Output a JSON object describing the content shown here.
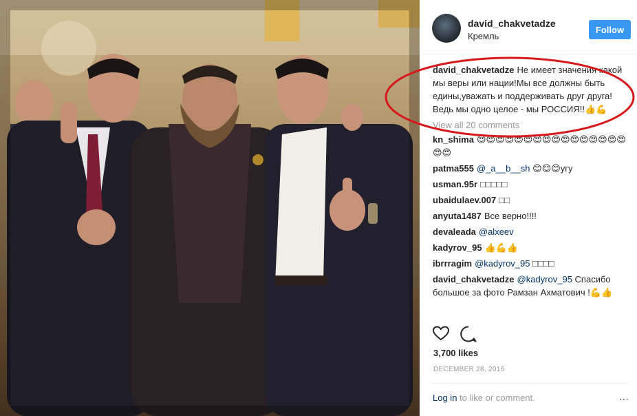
{
  "post": {
    "username": "david_chakvetadze",
    "location": "Кремль",
    "follow_label": "Follow",
    "caption_user": "david_chakvetadze",
    "caption_text": "Не имеет значения какой мы веры или нации!Мы все должны быть едины,уважать и поддерживать друг друга!Ведь мы одно целое - мы РОССИЯ!!👍💪",
    "view_all": "View all 20 comments",
    "likes": "3,700 likes",
    "date": "DECEMBER 28, 2016",
    "login_link": "Log in",
    "login_rest": " to like or comment.",
    "more_label": "···"
  },
  "comments": [
    {
      "user": "kn_shima",
      "mention": "",
      "text": "😍😍😍😍😍😍😍😍😍😍😍😍😍😍😍😍😍😍"
    },
    {
      "user": "patma555",
      "mention": "@_a__b__sh",
      "text": " 😊😊😊угу"
    },
    {
      "user": "usman.95r",
      "mention": "",
      "text": "□□□□□"
    },
    {
      "user": "ubaidulaev.007",
      "mention": "",
      "text": "□□"
    },
    {
      "user": "anyuta1487",
      "mention": "",
      "text": "Все верно!!!!"
    },
    {
      "user": "devaleada",
      "mention": "@alxeev",
      "text": ""
    },
    {
      "user": "kadyrov_95",
      "mention": "",
      "text": "👍💪👍"
    },
    {
      "user": "ibrrragim",
      "mention": "@kadyrov_95",
      "text": " □□□□"
    },
    {
      "user": "david_chakvetadze",
      "mention": "@kadyrov_95",
      "text": " Спасибо большое за фото Рамзан Ахматович !💪👍"
    }
  ],
  "icons": {
    "like": "heart-icon",
    "comment": "comment-icon"
  },
  "colors": {
    "follow": "#3897f0",
    "link": "#003569",
    "annotation": "#d7191c"
  }
}
